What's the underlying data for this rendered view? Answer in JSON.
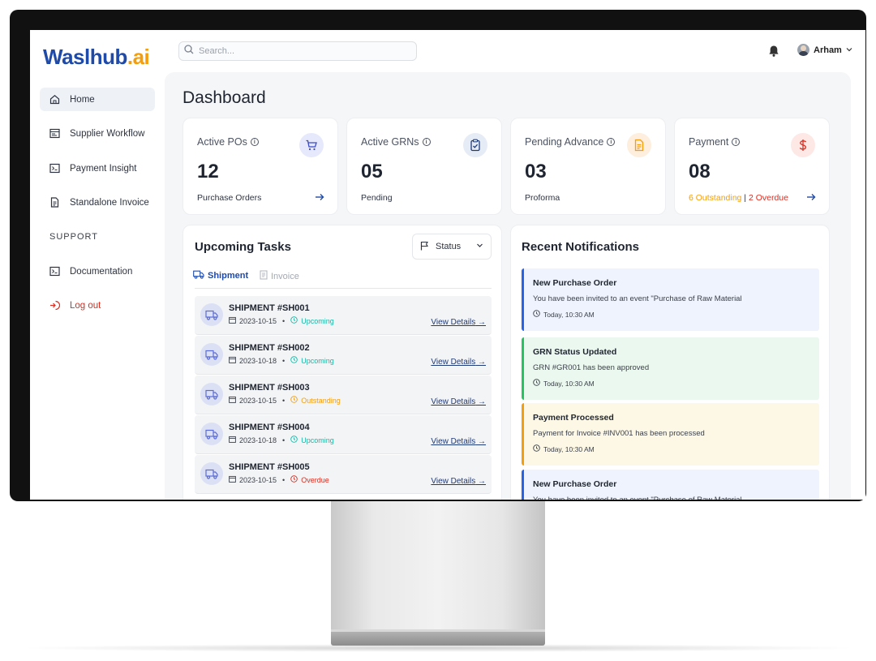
{
  "brand": {
    "name_part1": "Waslhub",
    "name_part2": ".ai"
  },
  "topbar": {
    "search_placeholder": "Search...",
    "user_name": "Arham"
  },
  "sidebar": {
    "items": [
      {
        "label": "Home",
        "icon": "home-icon"
      },
      {
        "label": "Supplier Workflow",
        "icon": "workflow-icon"
      },
      {
        "label": "Payment Insight",
        "icon": "terminal-icon"
      },
      {
        "label": "Standalone Invoice",
        "icon": "document-icon"
      }
    ],
    "support_label": "SUPPORT",
    "support_items": [
      {
        "label": "Documentation",
        "icon": "terminal-icon"
      },
      {
        "label": "Log out",
        "icon": "logout-icon"
      }
    ]
  },
  "page": {
    "title": "Dashboard"
  },
  "stats": [
    {
      "label": "Active POs",
      "value": "12",
      "sub": "Purchase Orders",
      "icon": "cart-icon",
      "color": "#e6e9fb"
    },
    {
      "label": "Active GRNs",
      "value": "05",
      "sub": "Pending",
      "icon": "clipboard-check-icon",
      "color": "#e6ecf5"
    },
    {
      "label": "Pending Advance",
      "value": "03",
      "sub": "Proforma",
      "icon": "file-icon",
      "color": "#fdeedd"
    },
    {
      "label": "Payment",
      "value": "08",
      "sub_outstanding": "6 Outstanding",
      "sub_sep": " | ",
      "sub_overdue": "2 Overdue",
      "icon": "dollar-icon",
      "color": "#fde8e6"
    }
  ],
  "tasks": {
    "title": "Upcoming Tasks",
    "status_label": "Status",
    "tabs": [
      {
        "label": "Shipment"
      },
      {
        "label": "Invoice"
      }
    ],
    "view_label": "View Details",
    "rows": [
      {
        "id": "SHIPMENT #SH001",
        "date": "2023-10-15",
        "status": "Upcoming"
      },
      {
        "id": "SHIPMENT #SH002",
        "date": "2023-10-18",
        "status": "Upcoming"
      },
      {
        "id": "SHIPMENT #SH003",
        "date": "2023-10-15",
        "status": "Outstanding"
      },
      {
        "id": "SHIPMENT #SH004",
        "date": "2023-10-18",
        "status": "Upcoming"
      },
      {
        "id": "SHIPMENT #SH005",
        "date": "2023-10-15",
        "status": "Overdue"
      }
    ]
  },
  "notifications": {
    "title": "Recent Notifications",
    "items": [
      {
        "title": "New Purchase Order",
        "body": "You have been invited to an event \"Purchase of Raw Material",
        "time": "Today, 10:30 AM",
        "tone": "blue"
      },
      {
        "title": "GRN Status Updated",
        "body": "GRN #GR001 has been approved",
        "time": "Today, 10:30 AM",
        "tone": "green"
      },
      {
        "title": "Payment Processed",
        "body": "Payment for Invoice #INV001 has been processed",
        "time": "Today, 10:30 AM",
        "tone": "yellow"
      },
      {
        "title": "New Purchase Order",
        "body": "You have been invited to an event \"Purchase of Raw Material",
        "time": "",
        "tone": "blue"
      }
    ]
  },
  "colors": {
    "brand_blue": "#1f4aa8",
    "brand_orange": "#f59e0b",
    "danger": "#d92d20",
    "teal": "#14b8a6"
  }
}
